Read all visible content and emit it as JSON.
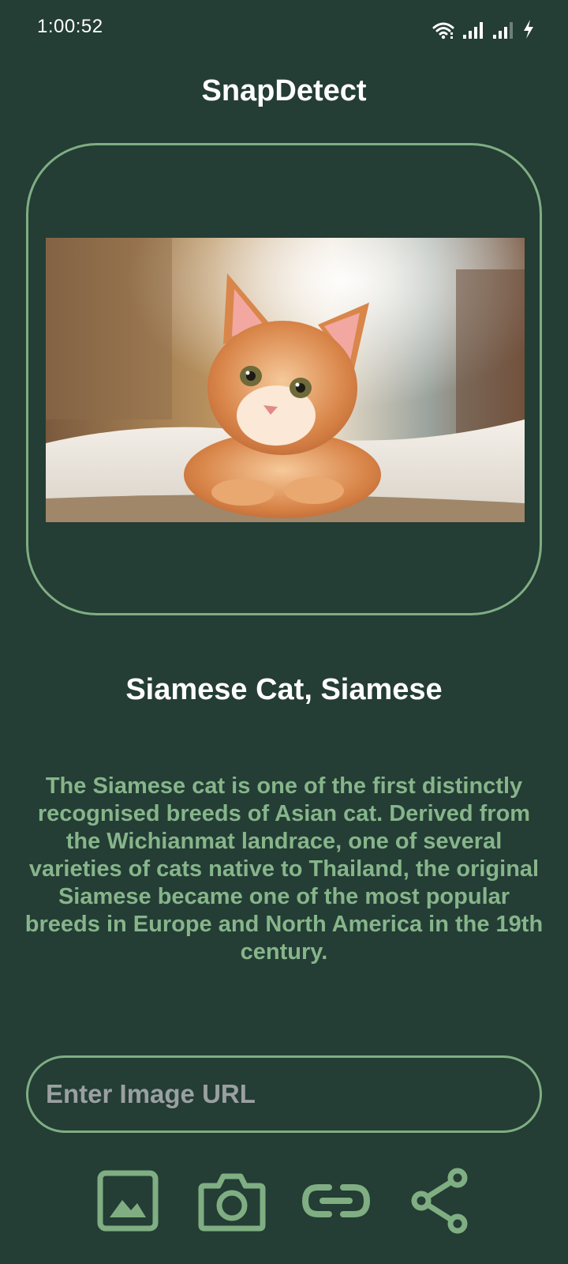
{
  "status_bar": {
    "time": "1:00:52",
    "icons": [
      "wifi-icon",
      "signal-icon",
      "signal-icon",
      "charging-icon"
    ]
  },
  "app": {
    "title": "SnapDetect"
  },
  "image_card": {
    "image": "kitten-photo"
  },
  "result": {
    "title": "Siamese Cat, Siamese",
    "description": "The Siamese cat is one of the first distinctly recognised breeds of Asian cat. Derived from the Wichianmat landrace, one of several varieties of cats native to Thailand, the original Siamese became one of the most popular breeds in Europe and North America in the 19th century."
  },
  "url_input": {
    "value": "",
    "placeholder": "Enter Image URL"
  },
  "actions": {
    "items": [
      {
        "icon": "gallery-icon"
      },
      {
        "icon": "camera-icon"
      },
      {
        "icon": "link-icon"
      },
      {
        "icon": "share-icon"
      }
    ]
  },
  "colors": {
    "background": "#243d35",
    "accent": "#7fae82",
    "description_text": "#86b58a",
    "title_text": "#ffffff"
  }
}
